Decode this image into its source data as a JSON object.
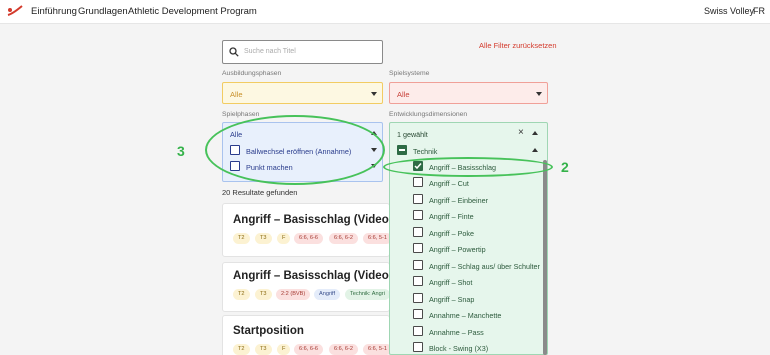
{
  "nav": {
    "items": [
      "Einführung",
      "Grundlagen",
      "Athletic Development Program"
    ],
    "brand": "Swiss Volley",
    "lang": "FR"
  },
  "search": {
    "placeholder": "Suche nach Titel"
  },
  "reset_label": "Alle Filter zurücksetzen",
  "filters": {
    "ausbildung": {
      "label": "Ausbildungsphasen",
      "value": "Alle"
    },
    "spielsysteme": {
      "label": "Spielsysteme",
      "value": "Alle"
    },
    "spielphasen": {
      "label": "Spielphasen",
      "value": "Alle",
      "options": [
        "Ballwechsel eröffnen (Annahme)",
        "Punkt machen"
      ]
    },
    "entwicklung": {
      "label": "Entwicklungsdimensionen",
      "value": "1 gewählt",
      "group": "Technik",
      "options": [
        "Angriff – Basisschlag",
        "Angriff – Cut",
        "Angriff – Einbeiner",
        "Angriff – Finte",
        "Angriff – Poke",
        "Angriff – Powertip",
        "Angriff – Schlag aus/ über Schulter",
        "Angriff – Shot",
        "Angriff – Snap",
        "Annahme – Manchette",
        "Annahme – Pass",
        "Block - Swing (X3)"
      ]
    }
  },
  "results_text": "20 Resultate gefunden",
  "cards": [
    {
      "title": "Angriff – Basisschlag (Video VB)",
      "tags": [
        "T2",
        "T3",
        "F",
        "6:6, 6-6",
        "6:6, 6-2",
        "6:6, 5-1"
      ]
    },
    {
      "title": "Angriff – Basisschlag (Video BVB)",
      "tags": [
        "T2",
        "T3",
        "2:2 (BVB)",
        "Angriff",
        "Technik: Angri"
      ]
    },
    {
      "title": "Startposition",
      "tags": [
        "T2",
        "T3",
        "F",
        "6:6, 6-6",
        "6:6, 6-2",
        "6:6, 5-1"
      ]
    }
  ],
  "annotations": [
    "3",
    "2"
  ],
  "colors": {
    "accent_red": "#d33a2c",
    "annotation_green": "#35b24a",
    "panel_blue": "#e8f0fc",
    "panel_green": "#e6f6ec"
  }
}
